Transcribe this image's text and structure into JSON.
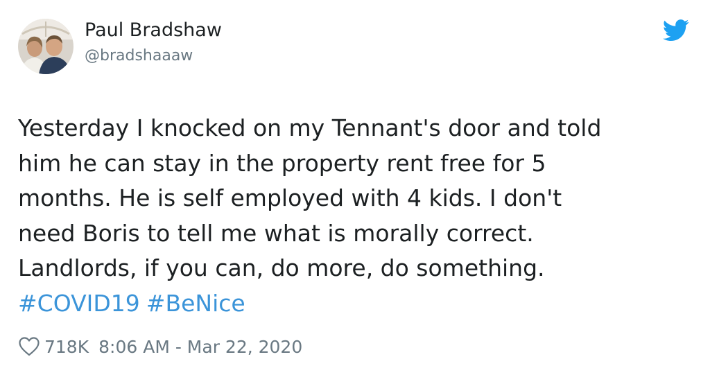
{
  "author": {
    "display_name": "Paul Bradshaw",
    "handle": "@bradshaaaw",
    "avatar_icon": "profile-photo"
  },
  "tweet": {
    "text": "Yesterday I knocked on my Tennant's door and told\nhim he can stay in the property rent free for 5\nmonths. He is self employed with 4 kids. I don't\nneed Boris to tell me what is morally correct.\nLandlords, if you can, do more, do something.",
    "hashtags": [
      "#COVID19",
      "#BeNice"
    ]
  },
  "meta": {
    "like_count": "718K",
    "timestamp": "8:06 AM - Mar 22, 2020"
  },
  "icons": {
    "brand": "twitter-bird-icon",
    "like": "heart-icon"
  },
  "colors": {
    "brand_blue": "#1da1f2",
    "hashtag_blue": "#3b94d9",
    "text_primary": "#1c2022",
    "text_secondary": "#697882"
  }
}
